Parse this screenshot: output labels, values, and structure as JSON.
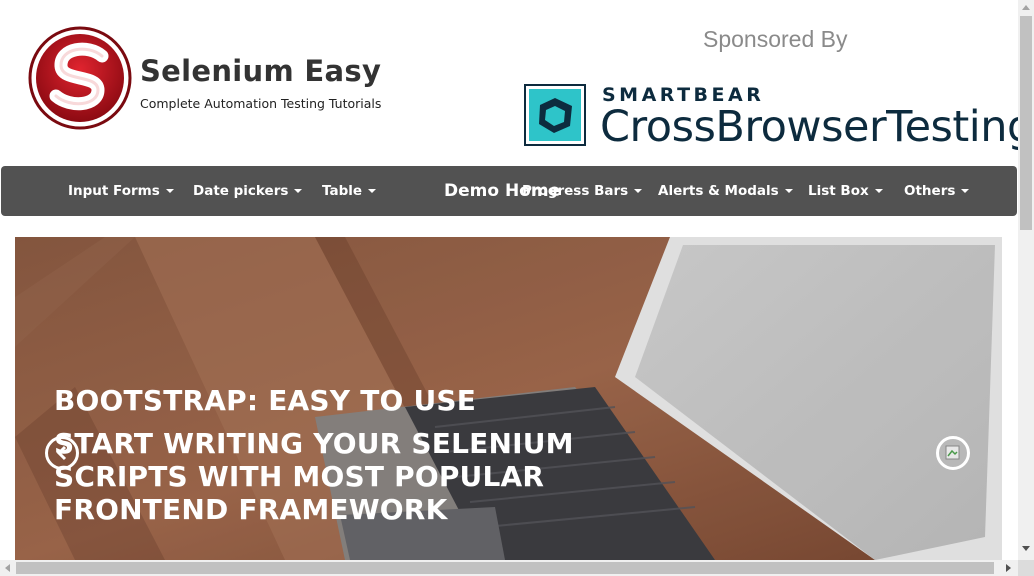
{
  "header": {
    "site_title": "Selenium Easy",
    "tagline": "Complete Automation Testing Tutorials",
    "sponsor_label": "Sponsored By",
    "sponsor_brand": "SMARTBEAR",
    "sponsor_product": "CrossBrowserTesting"
  },
  "nav": {
    "items": [
      {
        "label": "Input Forms"
      },
      {
        "label": "Date pickers"
      },
      {
        "label": "Table"
      },
      {
        "label": "Progress Bars"
      },
      {
        "label": "Alerts & Modals"
      },
      {
        "label": "List Box"
      },
      {
        "label": "Others"
      }
    ],
    "home_label": "Demo Home"
  },
  "carousel": {
    "heading": "BOOTSTRAP: EASY TO USE",
    "subheading": "START WRITING YOUR SELENIUM SCRIPTS WITH MOST POPULAR FRONTEND FRAMEWORK"
  },
  "colors": {
    "navbar_bg": "#525252",
    "logo_red": "#c0121e",
    "sponsor_teal": "#2ec4c9",
    "sponsor_navy": "#0d2b3e"
  }
}
